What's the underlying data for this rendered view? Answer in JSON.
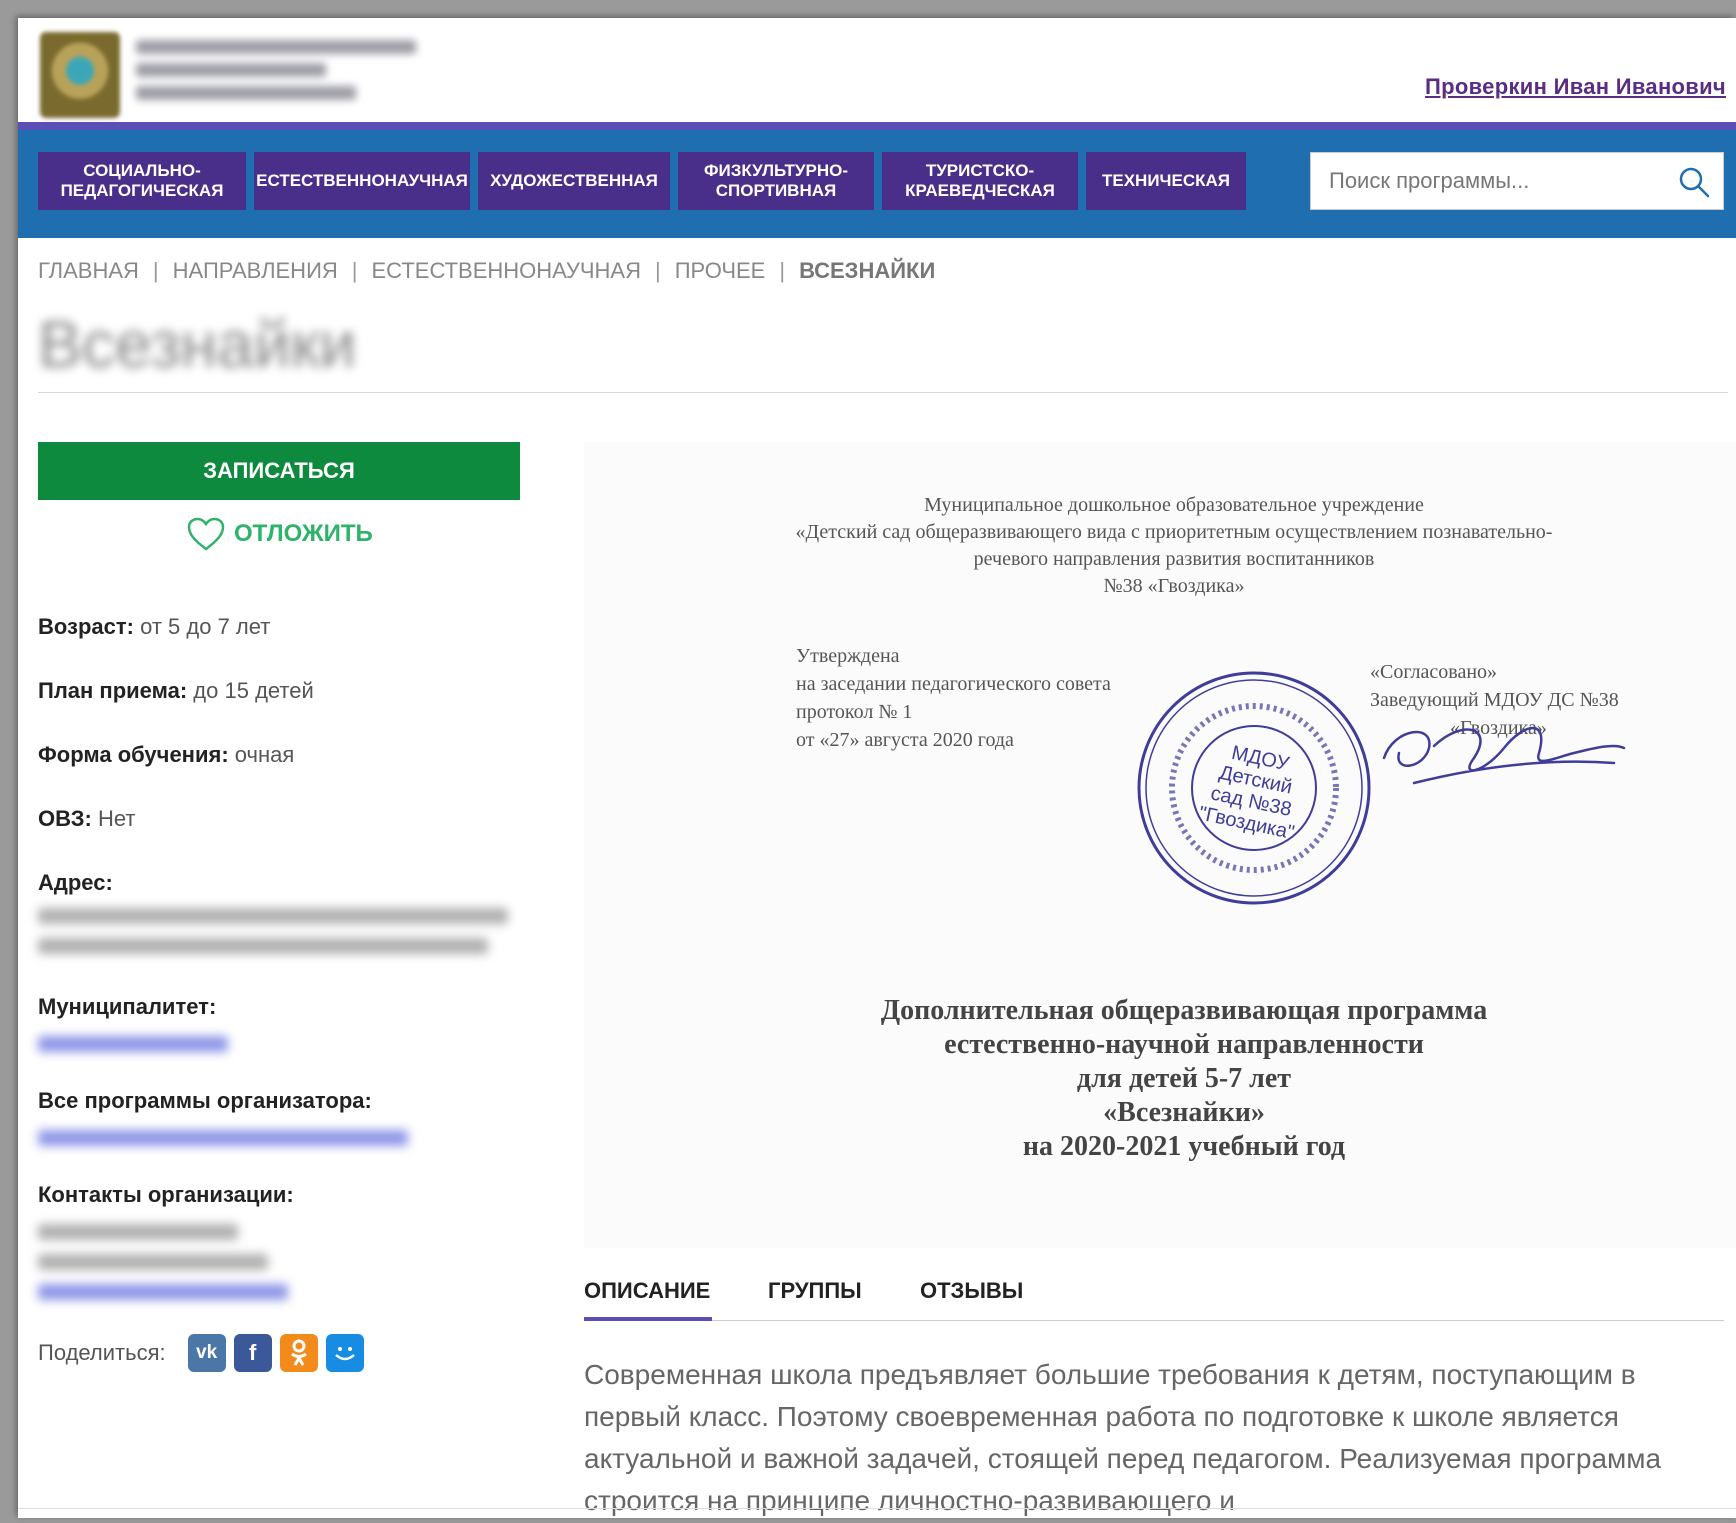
{
  "header": {
    "user_name": "Проверкин Иван Иванович"
  },
  "nav": {
    "tabs": [
      {
        "label": "СОЦИАЛЬНО-\nПЕДАГОГИЧЕСКАЯ"
      },
      {
        "label": "ЕСТЕСТВЕННОНАУЧНАЯ"
      },
      {
        "label": "ХУДОЖЕСТВЕННАЯ"
      },
      {
        "label": "ФИЗКУЛЬТУРНО-\nСПОРТИВНАЯ"
      },
      {
        "label": "ТУРИСТСКО-\nКРАЕВЕДЧЕСКАЯ"
      },
      {
        "label": "ТЕХНИЧЕСКАЯ"
      }
    ],
    "search_placeholder": "Поиск программы..."
  },
  "breadcrumb": {
    "items": [
      "ГЛАВНАЯ",
      "НАПРАВЛЕНИЯ",
      "ЕСТЕСТВЕННОНАУЧНАЯ",
      "ПРОЧЕЕ"
    ],
    "current": "ВСЕЗНАЙКИ"
  },
  "page_title": "Всезнайки",
  "actions": {
    "enroll_label": "ЗАПИСАТЬСЯ",
    "postpone_label": "ОТЛОЖИТЬ"
  },
  "info": {
    "age_label": "Возраст:",
    "age_value": "от 5 до 7 лет",
    "plan_label": "План приема:",
    "plan_value": "до 15 детей",
    "form_label": "Форма обучения:",
    "form_value": "очная",
    "ovz_label": "ОВЗ:",
    "ovz_value": "Нет",
    "address_label": "Адрес:",
    "municipality_label": "Муниципалитет:",
    "programs_label": "Все программы организатора:",
    "contacts_label": "Контакты организации:"
  },
  "share": {
    "label": "Поделиться:",
    "networks": [
      "vk-icon",
      "facebook-icon",
      "odnoklassniki-icon",
      "moimir-icon"
    ]
  },
  "document": {
    "header_lines": [
      "Муниципальное дошкольное образовательное учреждение",
      "«Детский сад общеразвивающего вида с приоритетным осуществлением познавательно-",
      "речевого направления развития воспитанников",
      "№38 «Гвоздика»"
    ],
    "approved_lines": [
      "Утверждена",
      "на заседании педагогического совета",
      "протокол № 1",
      "от «27» августа 2020 года"
    ],
    "agreed_lines": [
      "«Согласовано»",
      "Заведующий МДОУ ДС №38",
      "«Гвоздика»"
    ],
    "stamp_lines": [
      "МДОУ",
      "Детский",
      "сад №38",
      "\"Гвоздика\""
    ],
    "title_lines": [
      "Дополнительная общеразвивающая программа",
      "естественно-научной направленности",
      "для детей 5-7 лет",
      "«Всезнайки»",
      "на 2020-2021 учебный год"
    ]
  },
  "content_tabs": [
    "ОПИСАНИЕ",
    "ГРУППЫ",
    "ОТЗЫВЫ"
  ],
  "description": "Современная школа предъявляет большие требования к детям, поступающим в первый класс. Поэтому своевременная работа по подготовке к школе является актуальной и важной задачей, стоящей перед педагогом. Реализуемая программа строится на принципе личностно-развивающего и",
  "colors": {
    "nav_bg": "#1f6fb0",
    "tab_bg": "#4a2f8a",
    "accent": "#5b4fb7",
    "enroll_green": "#0e8a3e",
    "postpone_green": "#2fb36b",
    "user_link": "#5a2d82"
  }
}
